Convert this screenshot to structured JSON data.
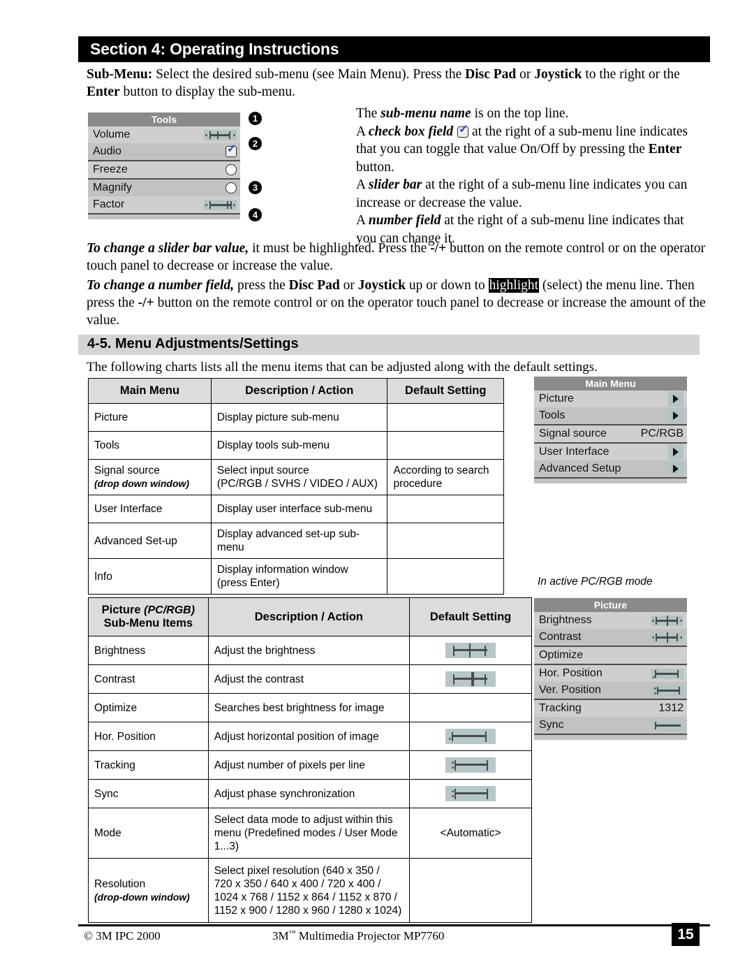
{
  "header": {
    "section_title": "Section 4: Operating Instructions"
  },
  "intro": {
    "label": "Sub-Menu:",
    "text_1": " Select the desired sub-menu (see Main Menu). Press the ",
    "bold_1": "Disc Pad",
    "text_2": " or ",
    "bold_2": "Joystick",
    "text_3": " to the right or the ",
    "bold_3": "Enter",
    "text_4": " button to display the sub-menu."
  },
  "explanations": {
    "line1_a": "The ",
    "line1_b": "sub-menu name",
    "line1_c": " is on the top line.",
    "line2_a": "A ",
    "line2_b": "check box field",
    "line2_c": " at the right of a sub-menu line indicates that you can toggle that value On/Off by pressing the ",
    "line2_d": "Enter",
    "line2_e": " button.",
    "line3_a": "A ",
    "line3_b": "slider bar",
    "line3_c": " at the right of a sub-menu line indicates you can increase or decrease the value.",
    "line4_a": "A ",
    "line4_b": "number field",
    "line4_c": " at the right of a sub-menu line indicates that you can change it."
  },
  "callouts": [
    "1",
    "2",
    "3",
    "4"
  ],
  "tools_osd": {
    "title": "Tools",
    "rows": [
      {
        "label": "Volume",
        "control": "slider"
      },
      {
        "label": "Audio",
        "control": "checkbox"
      },
      {
        "label": "Freeze",
        "control": "circle"
      },
      {
        "label": "Magnify",
        "control": "circle"
      },
      {
        "label": "Factor",
        "control": "slider"
      }
    ]
  },
  "slider_para": {
    "bold": "To change a slider bar value,",
    "text_a": " it must be highlighted.  Press the ",
    "bold_b": "-/+",
    "text_b": " button on the remote control or on the operator touch panel to decrease or increase the value."
  },
  "number_para": {
    "bold": "To change a number field,",
    "text_a": " press the ",
    "bold_b": "Disc Pad",
    "text_b": " or ",
    "bold_c": "Joystick",
    "text_c": " up or down to ",
    "highlight": "highlight",
    "text_d": " (select) the menu line. Then press the ",
    "bold_d": "-/+",
    "text_e": " button on the remote control or on the operator touch panel to decrease or increase the amount of the value."
  },
  "subsection": {
    "heading": "4-5. Menu Adjustments/Settings",
    "intro": "The following charts lists all the menu items that can be adjusted along with the default settings."
  },
  "main_table": {
    "headers": [
      "Main Menu",
      "Description / Action",
      "Default Setting"
    ],
    "rows": [
      {
        "name": "Picture",
        "sub": "",
        "desc": "Display picture sub-menu",
        "desc2": "",
        "default": ""
      },
      {
        "name": "Tools",
        "sub": "",
        "desc": "Display tools sub-menu",
        "desc2": "",
        "default": ""
      },
      {
        "name": "Signal source",
        "sub": "(drop down window)",
        "desc": "Select input source",
        "desc2": "(PC/RGB / SVHS / VIDEO / AUX)",
        "default": "According to search procedure"
      },
      {
        "name": "User Interface",
        "sub": "",
        "desc": "Display user interface sub-menu",
        "desc2": "",
        "default": ""
      },
      {
        "name": "Advanced Set-up",
        "sub": "",
        "desc": "Display advanced set-up sub-menu",
        "desc2": "",
        "default": ""
      },
      {
        "name": "Info",
        "sub": "",
        "desc": "Display information window",
        "desc2": "(press Enter)",
        "default": ""
      }
    ]
  },
  "main_menu_osd": {
    "title": "Main Menu",
    "rows": [
      {
        "label": "Picture",
        "control": "arrow",
        "value": ""
      },
      {
        "label": "Tools",
        "control": "arrow",
        "value": ""
      },
      {
        "label": "Signal source",
        "control": "value",
        "value": "PC/RGB"
      },
      {
        "label": "User Interface",
        "control": "arrow",
        "value": ""
      },
      {
        "label": "Advanced Setup",
        "control": "arrow",
        "value": ""
      }
    ]
  },
  "mode_note": "In active PC/RGB mode",
  "picture_table": {
    "headers": [
      "Picture (PC/RGB) Sub-Menu Items",
      "Description / Action",
      "Default Setting"
    ],
    "header_col1_line1_a": "Picture ",
    "header_col1_line1_b": "(PC/RGB)",
    "header_col1_line2": "Sub-Menu Items",
    "rows": [
      {
        "name": "Brightness",
        "sub": "",
        "desc": "Adjust the brightness",
        "desc2": "",
        "desc3": "",
        "desc4": "",
        "default": "",
        "default_glyph": "slider-center"
      },
      {
        "name": "Contrast",
        "sub": "",
        "desc": "Adjust the contrast",
        "desc2": "",
        "desc3": "",
        "desc4": "",
        "default": "",
        "default_glyph": "slider-center"
      },
      {
        "name": "Optimize",
        "sub": "",
        "desc": "Searches best brightness for image",
        "desc2": "",
        "desc3": "",
        "desc4": "",
        "default": "",
        "default_glyph": "none"
      },
      {
        "name": "Hor. Position",
        "sub": "",
        "desc": "Adjust horizontal position of image",
        "desc2": "",
        "desc3": "",
        "desc4": "",
        "default": "",
        "default_glyph": "slider-right"
      },
      {
        "name": "Tracking",
        "sub": "",
        "desc": "Adjust number of pixels per line",
        "desc2": "",
        "desc3": "",
        "desc4": "",
        "default": "",
        "default_glyph": "slider-left"
      },
      {
        "name": "Sync",
        "sub": "",
        "desc": "Adjust phase synchronization",
        "desc2": "",
        "desc3": "",
        "desc4": "",
        "default": "",
        "default_glyph": "slider-left"
      },
      {
        "name": "Mode",
        "sub": "",
        "desc": "Select data mode to adjust within this",
        "desc2": "menu (Predefined modes / User Mode",
        "desc3": "1...3)",
        "desc4": "",
        "default": "<Automatic>",
        "default_glyph": "none"
      },
      {
        "name": "Resolution",
        "sub": "(drop-down window)",
        "desc": "Select pixel resolution (640 x 350 /",
        "desc2": "720 x 350 / 640 x 400 / 720 x 400 /",
        "desc3": "1024 x 768 / 1152 x 864 / 1152 x 870 /",
        "desc4": "1152 x 900 / 1280 x 960 / 1280 x 1024)",
        "default": "",
        "default_glyph": "none"
      }
    ]
  },
  "picture_osd": {
    "title": "Picture",
    "rows": [
      {
        "label": "Brightness",
        "control": "slider-center",
        "value": ""
      },
      {
        "label": "Contrast",
        "control": "slider-center",
        "value": ""
      },
      {
        "label": "Optimize",
        "control": "none",
        "value": ""
      },
      {
        "label": "Hor. Position",
        "control": "slider-right",
        "value": ""
      },
      {
        "label": "Ver. Position",
        "control": "slider-leftish",
        "value": ""
      },
      {
        "label": "Tracking",
        "control": "value",
        "value": "1312"
      },
      {
        "label": "Sync",
        "control": "slider-far-left",
        "value": ""
      }
    ]
  },
  "footer": {
    "left": "© 3M IPC 2000",
    "center_a": "3M",
    "center_tm": "™",
    "center_b": " Multimedia Projector MP7760",
    "page": "15"
  }
}
